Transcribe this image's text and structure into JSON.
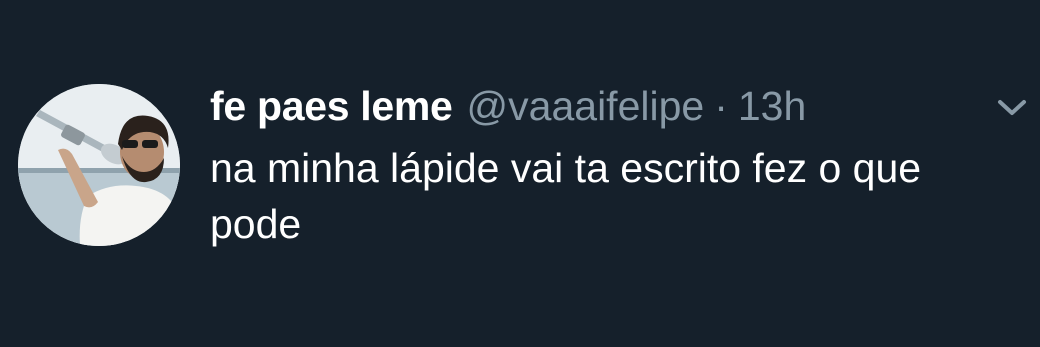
{
  "tweet": {
    "display_name": "fe paes leme",
    "handle": "@vaaaifelipe",
    "separator": "·",
    "timestamp": "13h",
    "text": "na minha lápide vai ta escrito fez o que pode"
  },
  "icons": {
    "menu": "chevron-down-icon"
  },
  "colors": {
    "background": "#15202b",
    "primary_text": "#ffffff",
    "secondary_text": "#8899a6"
  }
}
